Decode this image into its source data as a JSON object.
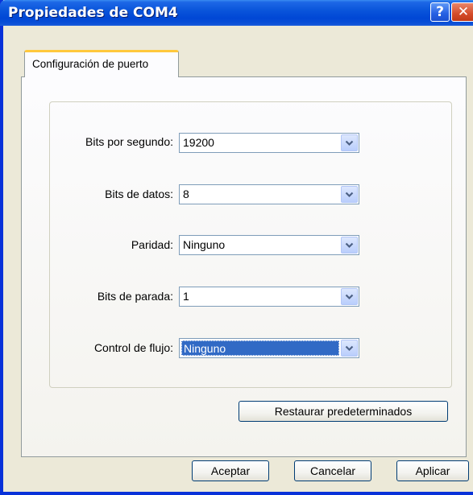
{
  "window": {
    "title": "Propiedades de COM4",
    "help_glyph": "?",
    "close_glyph": "✕"
  },
  "tab": {
    "label": "Configuración de puerto"
  },
  "fields": [
    {
      "label": "Bits por segundo:",
      "value": "19200"
    },
    {
      "label": "Bits de datos:",
      "value": "8"
    },
    {
      "label": "Paridad:",
      "value": "Ninguno"
    },
    {
      "label": "Bits de parada:",
      "value": "1"
    },
    {
      "label": "Control de flujo:",
      "value": "Ninguno"
    }
  ],
  "buttons": {
    "restore": "Restaurar predeterminados",
    "ok": "Aceptar",
    "cancel": "Cancelar",
    "apply": "Aplicar"
  },
  "colors": {
    "titlebar": "#0A55DB",
    "selection": "#316AC5",
    "tab_highlight": "#FFC83C"
  }
}
